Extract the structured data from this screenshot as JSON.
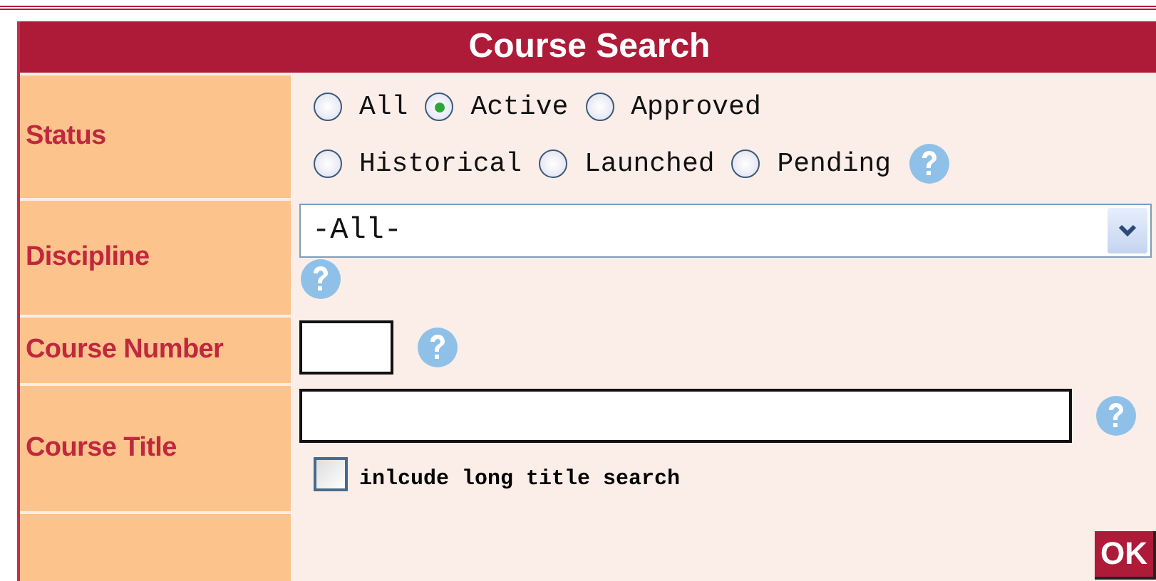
{
  "title": "Course Search",
  "rows": [
    {
      "kind": "radios",
      "label": "Status",
      "options": [
        {
          "label": "All",
          "selected": false
        },
        {
          "label": "Active",
          "selected": true
        },
        {
          "label": "Approved",
          "selected": false
        },
        {
          "label": "Historical",
          "selected": false
        },
        {
          "label": "Launched",
          "selected": false
        },
        {
          "label": "Pending",
          "selected": false
        }
      ]
    },
    {
      "kind": "select",
      "label": "Discipline",
      "value": "-All-"
    },
    {
      "kind": "short",
      "label": "Course Number"
    },
    {
      "kind": "long",
      "label": "Course Title",
      "checkbox": {
        "label": "inlcude long title search",
        "checked": false
      }
    }
  ],
  "button": "OK"
}
